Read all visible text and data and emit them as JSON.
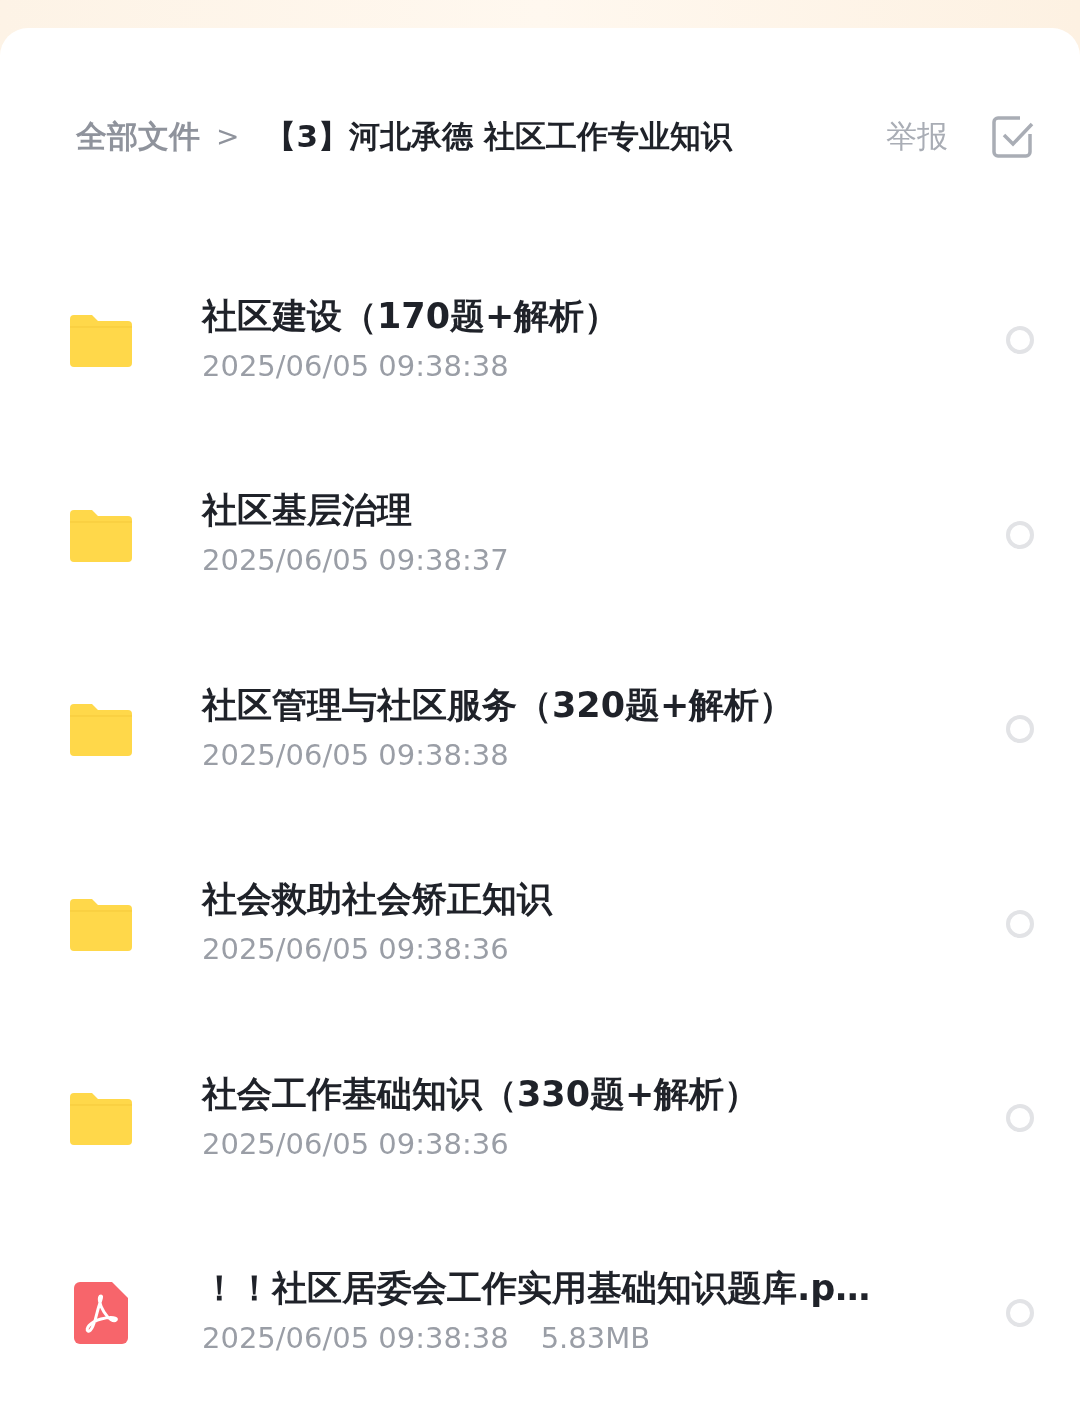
{
  "breadcrumb": {
    "root": "全部文件",
    "separator": ">",
    "current": "【3】河北承德 社区工作专业知识"
  },
  "report": "举报",
  "files": [
    {
      "kind": "folder",
      "name": "社区建设（170题+解析）",
      "date": "2025/06/05 09:38:38",
      "selected": false
    },
    {
      "kind": "folder",
      "name": "社区基层治理",
      "date": "2025/06/05 09:38:37",
      "selected": false
    },
    {
      "kind": "folder",
      "name": "社区管理与社区服务（320题+解析）",
      "date": "2025/06/05 09:38:38",
      "selected": false
    },
    {
      "kind": "folder",
      "name": "社会救助社会矫正知识",
      "date": "2025/06/05 09:38:36",
      "selected": false
    },
    {
      "kind": "folder",
      "name": "社会工作基础知识（330题+解析）",
      "date": "2025/06/05 09:38:36",
      "selected": false
    },
    {
      "kind": "pdf",
      "name": "！！社区居委会工作实用基础知识题库.p…",
      "date": "2025/06/05 09:38:38",
      "size": "5.83MB",
      "selected": false
    }
  ]
}
